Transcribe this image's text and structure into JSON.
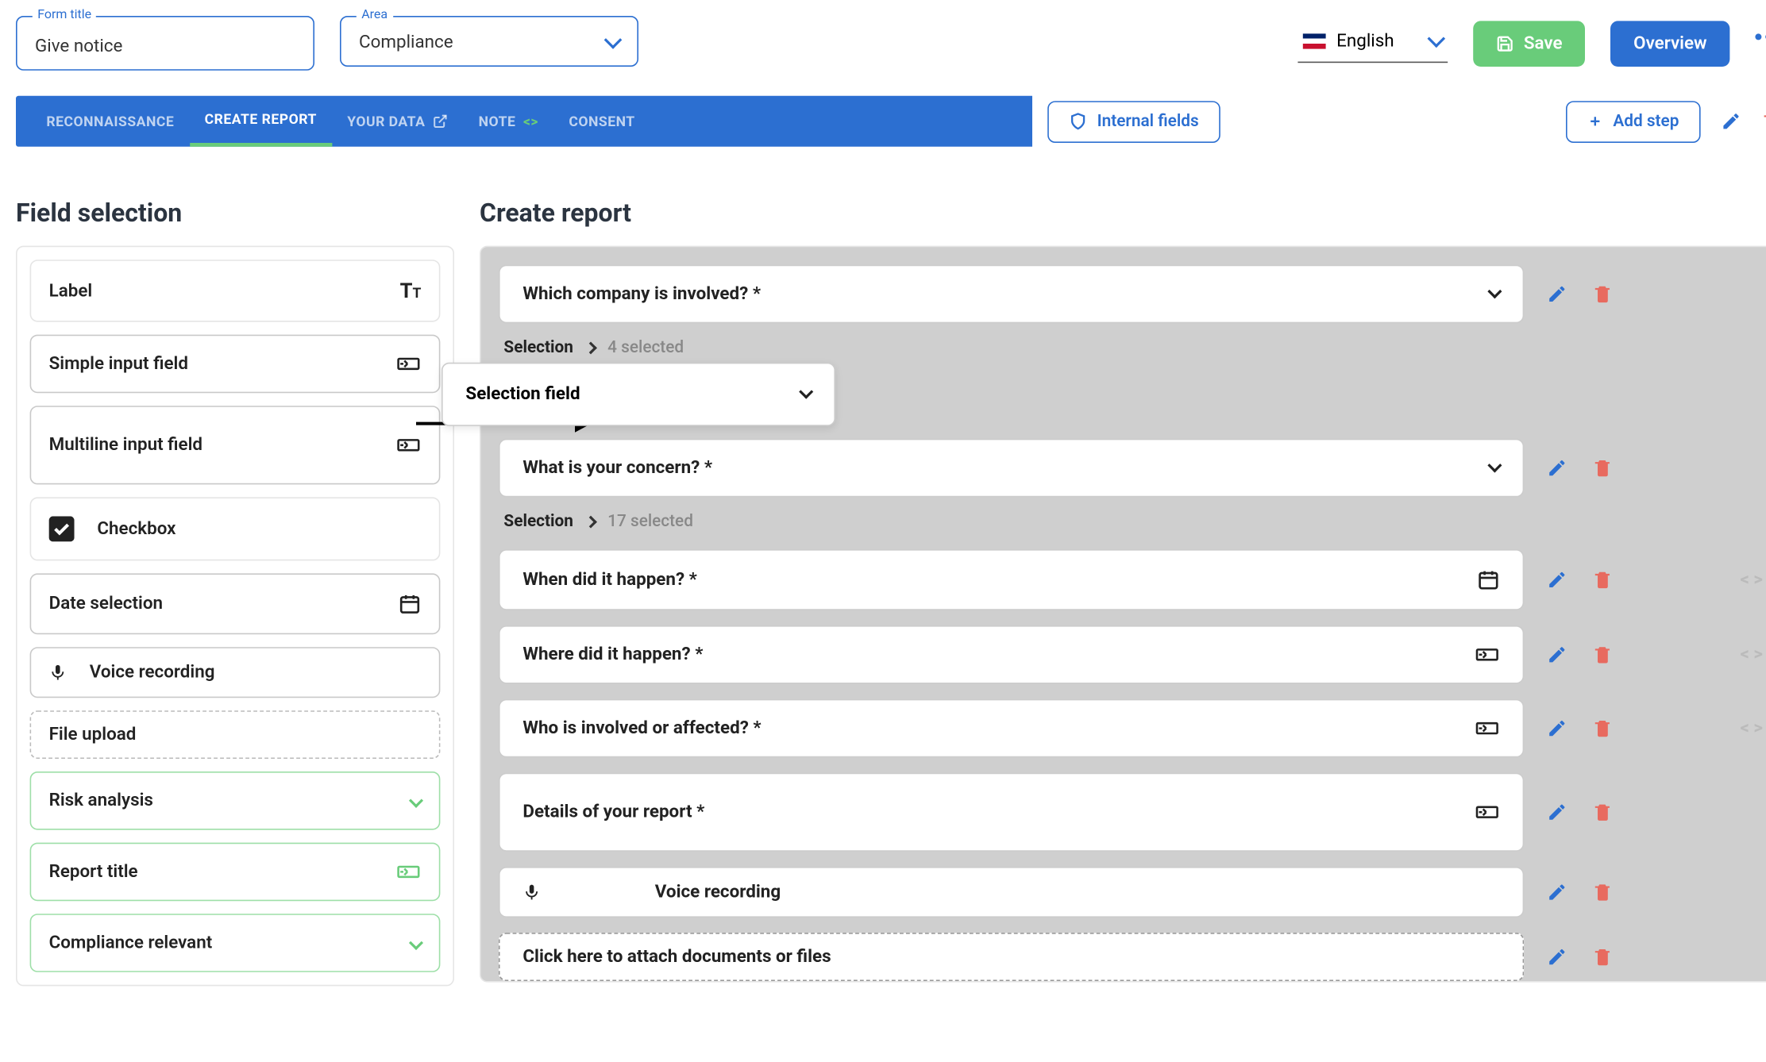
{
  "header": {
    "form_title_label": "Form title",
    "form_title_value": "Give notice",
    "area_label": "Area",
    "area_value": "Compliance",
    "language": "English",
    "save_label": "Save",
    "overview_label": "Overview"
  },
  "tabs": {
    "reconnaissance": "RECONNAISSANCE",
    "create_report": "CREATE REPORT",
    "your_data": "YOUR DATA",
    "note": "NOTE",
    "consent": "CONSENT"
  },
  "toolbar": {
    "internal_fields": "Internal fields",
    "add_step": "Add step"
  },
  "left_title": "Field selection",
  "right_title": "Create report",
  "palette": {
    "label": "Label",
    "simple_input": "Simple input field",
    "multiline_input": "Multiline input field",
    "checkbox": "Checkbox",
    "date_selection": "Date selection",
    "voice_recording": "Voice recording",
    "file_upload": "File upload",
    "risk_analysis": "Risk analysis",
    "report_title": "Report title",
    "compliance_relevant": "Compliance relevant"
  },
  "float_card": "Selection field",
  "questions": {
    "q1": "Which company is involved? *",
    "q1_sel_label": "Selection",
    "q1_sel_count": "4 selected",
    "q2": "What is your concern? *",
    "q2_sel_label": "Selection",
    "q2_sel_count": "17 selected",
    "q3": "When did it happen? *",
    "q4": "Where did it happen? *",
    "q5": "Who is involved or affected? *",
    "q6": "Details of your report *",
    "q7": "Voice recording",
    "q8": "Click here to attach documents or files"
  }
}
